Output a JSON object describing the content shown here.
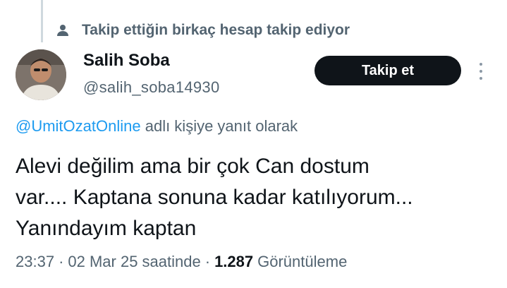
{
  "social_context": {
    "text": "Takip ettiğin birkaç hesap takip ediyor"
  },
  "author": {
    "name": "Salih Soba",
    "handle": "@salih_soba14930"
  },
  "follow_button": {
    "label": "Takip et"
  },
  "reply": {
    "mention": "@UmitOzatOnline",
    "suffix": " adlı kişiye yanıt olarak"
  },
  "tweet": {
    "lines": [
      "Alevi değilim ama bir çok Can dostum",
      "var.... Kaptana sonuna kadar katılıyorum...",
      "Yanındayım kaptan"
    ]
  },
  "meta": {
    "time": "23:37",
    "separator": "·",
    "date": "02 Mar 25 saatinde",
    "views_count": "1.287",
    "views_label": "Görüntüleme"
  },
  "colors": {
    "primary_text": "#0f1419",
    "secondary_text": "#536471",
    "link": "#1d9bf0",
    "button_bg": "#0f1419"
  },
  "icons": {
    "social_context": "person-icon",
    "more": "more-dots-icon"
  }
}
